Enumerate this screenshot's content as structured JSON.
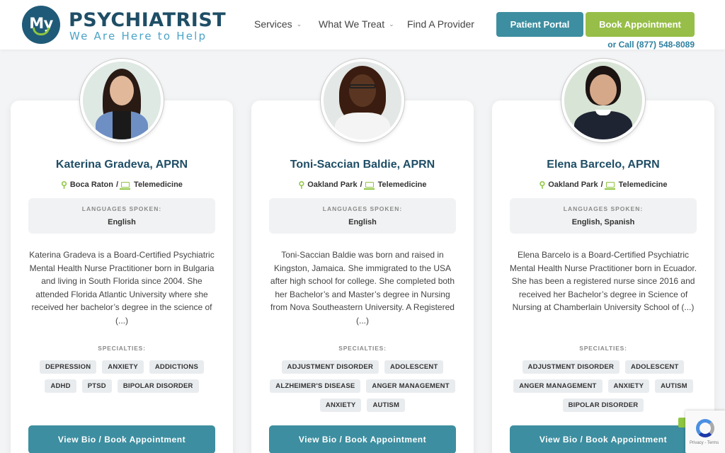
{
  "header": {
    "logo_my": "My",
    "brand_name": "PSYCHIATRIST",
    "brand_tagline": "We Are Here to Help",
    "nav": [
      {
        "label": "Services",
        "dropdown": true
      },
      {
        "label": "What We Treat",
        "dropdown": true
      },
      {
        "label": "Find A Provider",
        "dropdown": false
      }
    ],
    "portal_label": "Patient Portal",
    "book_label": "Book Appointment",
    "call_text": "or Call (877) 548-8089"
  },
  "providers": [
    {
      "name": "Katerina Gradeva, APRN",
      "location": "Boca Raton",
      "telemed": "Telemedicine",
      "languages_title": "LANGUAGES SPOKEN:",
      "languages": "English",
      "bio": "Katerina Gradeva is a Board-Certified Psychiatric Mental Health Nurse Practitioner born in Bulgaria and living in South Florida since 2004. She attended Florida Atlantic University where she received her bachelor’s degree in the science of (...)",
      "specialties_title": "SPECIALTIES:",
      "specialties": [
        "DEPRESSION",
        "ANXIETY",
        "ADDICTIONS",
        "ADHD",
        "PTSD",
        "BIPOLAR DISORDER"
      ],
      "button": "View Bio / Book Appointment"
    },
    {
      "name": "Toni-Saccian Baldie, APRN",
      "location": "Oakland Park",
      "telemed": "Telemedicine",
      "languages_title": "LANGUAGES SPOKEN:",
      "languages": "English",
      "bio": "Toni-Saccian Baldie was born and raised in Kingston, Jamaica. She immigrated to the USA after high school for college. She completed both her Bachelor’s and Master’s degree in Nursing from Nova Southeastern University. A Registered (...)",
      "specialties_title": "SPECIALTIES:",
      "specialties": [
        "ADJUSTMENT DISORDER",
        "ADOLESCENT",
        "ALZHEIMER'S DISEASE",
        "ANGER MANAGEMENT",
        "ANXIETY",
        "AUTISM"
      ],
      "button": "View Bio / Book Appointment"
    },
    {
      "name": "Elena Barcelo, APRN",
      "location": "Oakland Park",
      "telemed": "Telemedicine",
      "languages_title": "LANGUAGES SPOKEN:",
      "languages": "English,  Spanish",
      "bio": "Elena Barcelo is a Board-Certified Psychiatric Mental Health Nurse Practitioner born in Ecuador. She has been a registered nurse since 2016 and received her Bachelor’s degree in Science of Nursing at Chamberlain University School of (...)",
      "specialties_title": "SPECIALTIES:",
      "specialties": [
        "ADJUSTMENT DISORDER",
        "ADOLESCENT",
        "ANGER MANAGEMENT",
        "ANXIETY",
        "AUTISM",
        "BIPOLAR DISORDER"
      ],
      "button": "View Bio / Book Appointment"
    }
  ],
  "recaptcha": {
    "terms": "Privacy - Terms"
  },
  "colors": {
    "brand_dark": "#1f4e66",
    "accent_teal": "#3d8ea0",
    "accent_green": "#97be48"
  }
}
